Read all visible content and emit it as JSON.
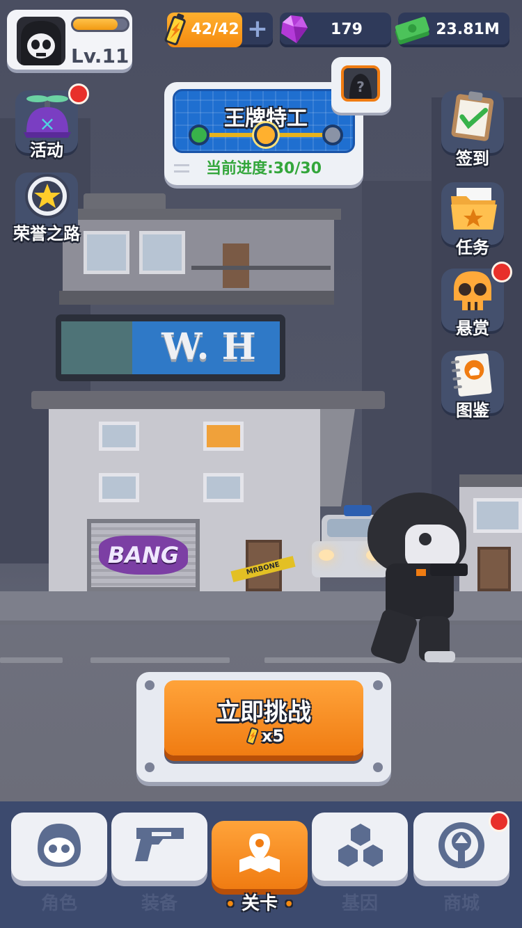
{
  "player": {
    "level": "Lv.11",
    "xp_progress": 0.82,
    "avatar_icon": "skull-hood-avatar"
  },
  "resources": {
    "energy": {
      "value": "42/42",
      "icon": "battery-icon",
      "add": "+"
    },
    "gems": {
      "value": "179",
      "icon": "gem-icon"
    },
    "cash": {
      "value": "23.81M",
      "icon": "cash-icon"
    }
  },
  "rank": {
    "title": "王牌特工",
    "progress_text": "当前进度:30/30",
    "nodes": 3,
    "current_node": 2,
    "next_reward_icon": "question-mark-icon"
  },
  "left_buttons": [
    {
      "label": "活动",
      "icon": "propeller-cap-icon",
      "badge": true
    },
    {
      "label": "荣誉之路",
      "icon": "star-medal-icon",
      "badge": false
    }
  ],
  "right_buttons": [
    {
      "label": "签到",
      "icon": "clipboard-check-icon",
      "badge": false
    },
    {
      "label": "任务",
      "icon": "folder-star-icon",
      "badge": false
    },
    {
      "label": "悬赏",
      "icon": "skull-icon",
      "badge": true
    },
    {
      "label": "图鉴",
      "icon": "notebook-icon",
      "badge": false
    }
  ],
  "scene": {
    "building_sign": "W. H",
    "graffiti": "BANG",
    "tape": "MRBONE"
  },
  "challenge": {
    "label": "立即挑战",
    "cost": "x5",
    "cost_icon": "battery-icon"
  },
  "nav": {
    "active_index": 2,
    "items": [
      {
        "label": "角色",
        "icon": "skull-mask-icon",
        "badge": false
      },
      {
        "label": "装备",
        "icon": "gun-icon",
        "badge": false
      },
      {
        "label": "关卡",
        "icon": "map-pin-icon",
        "badge": false
      },
      {
        "label": "基因",
        "icon": "hexagon-cluster-icon",
        "badge": false
      },
      {
        "label": "商城",
        "icon": "shop-emblem-icon",
        "badge": true
      }
    ],
    "active_marks": "•"
  },
  "colors": {
    "accent_orange": "#f48a10",
    "badge_red": "#e8302a",
    "progress_green": "#33a63b",
    "nav_bg": "#3c4a6e"
  }
}
